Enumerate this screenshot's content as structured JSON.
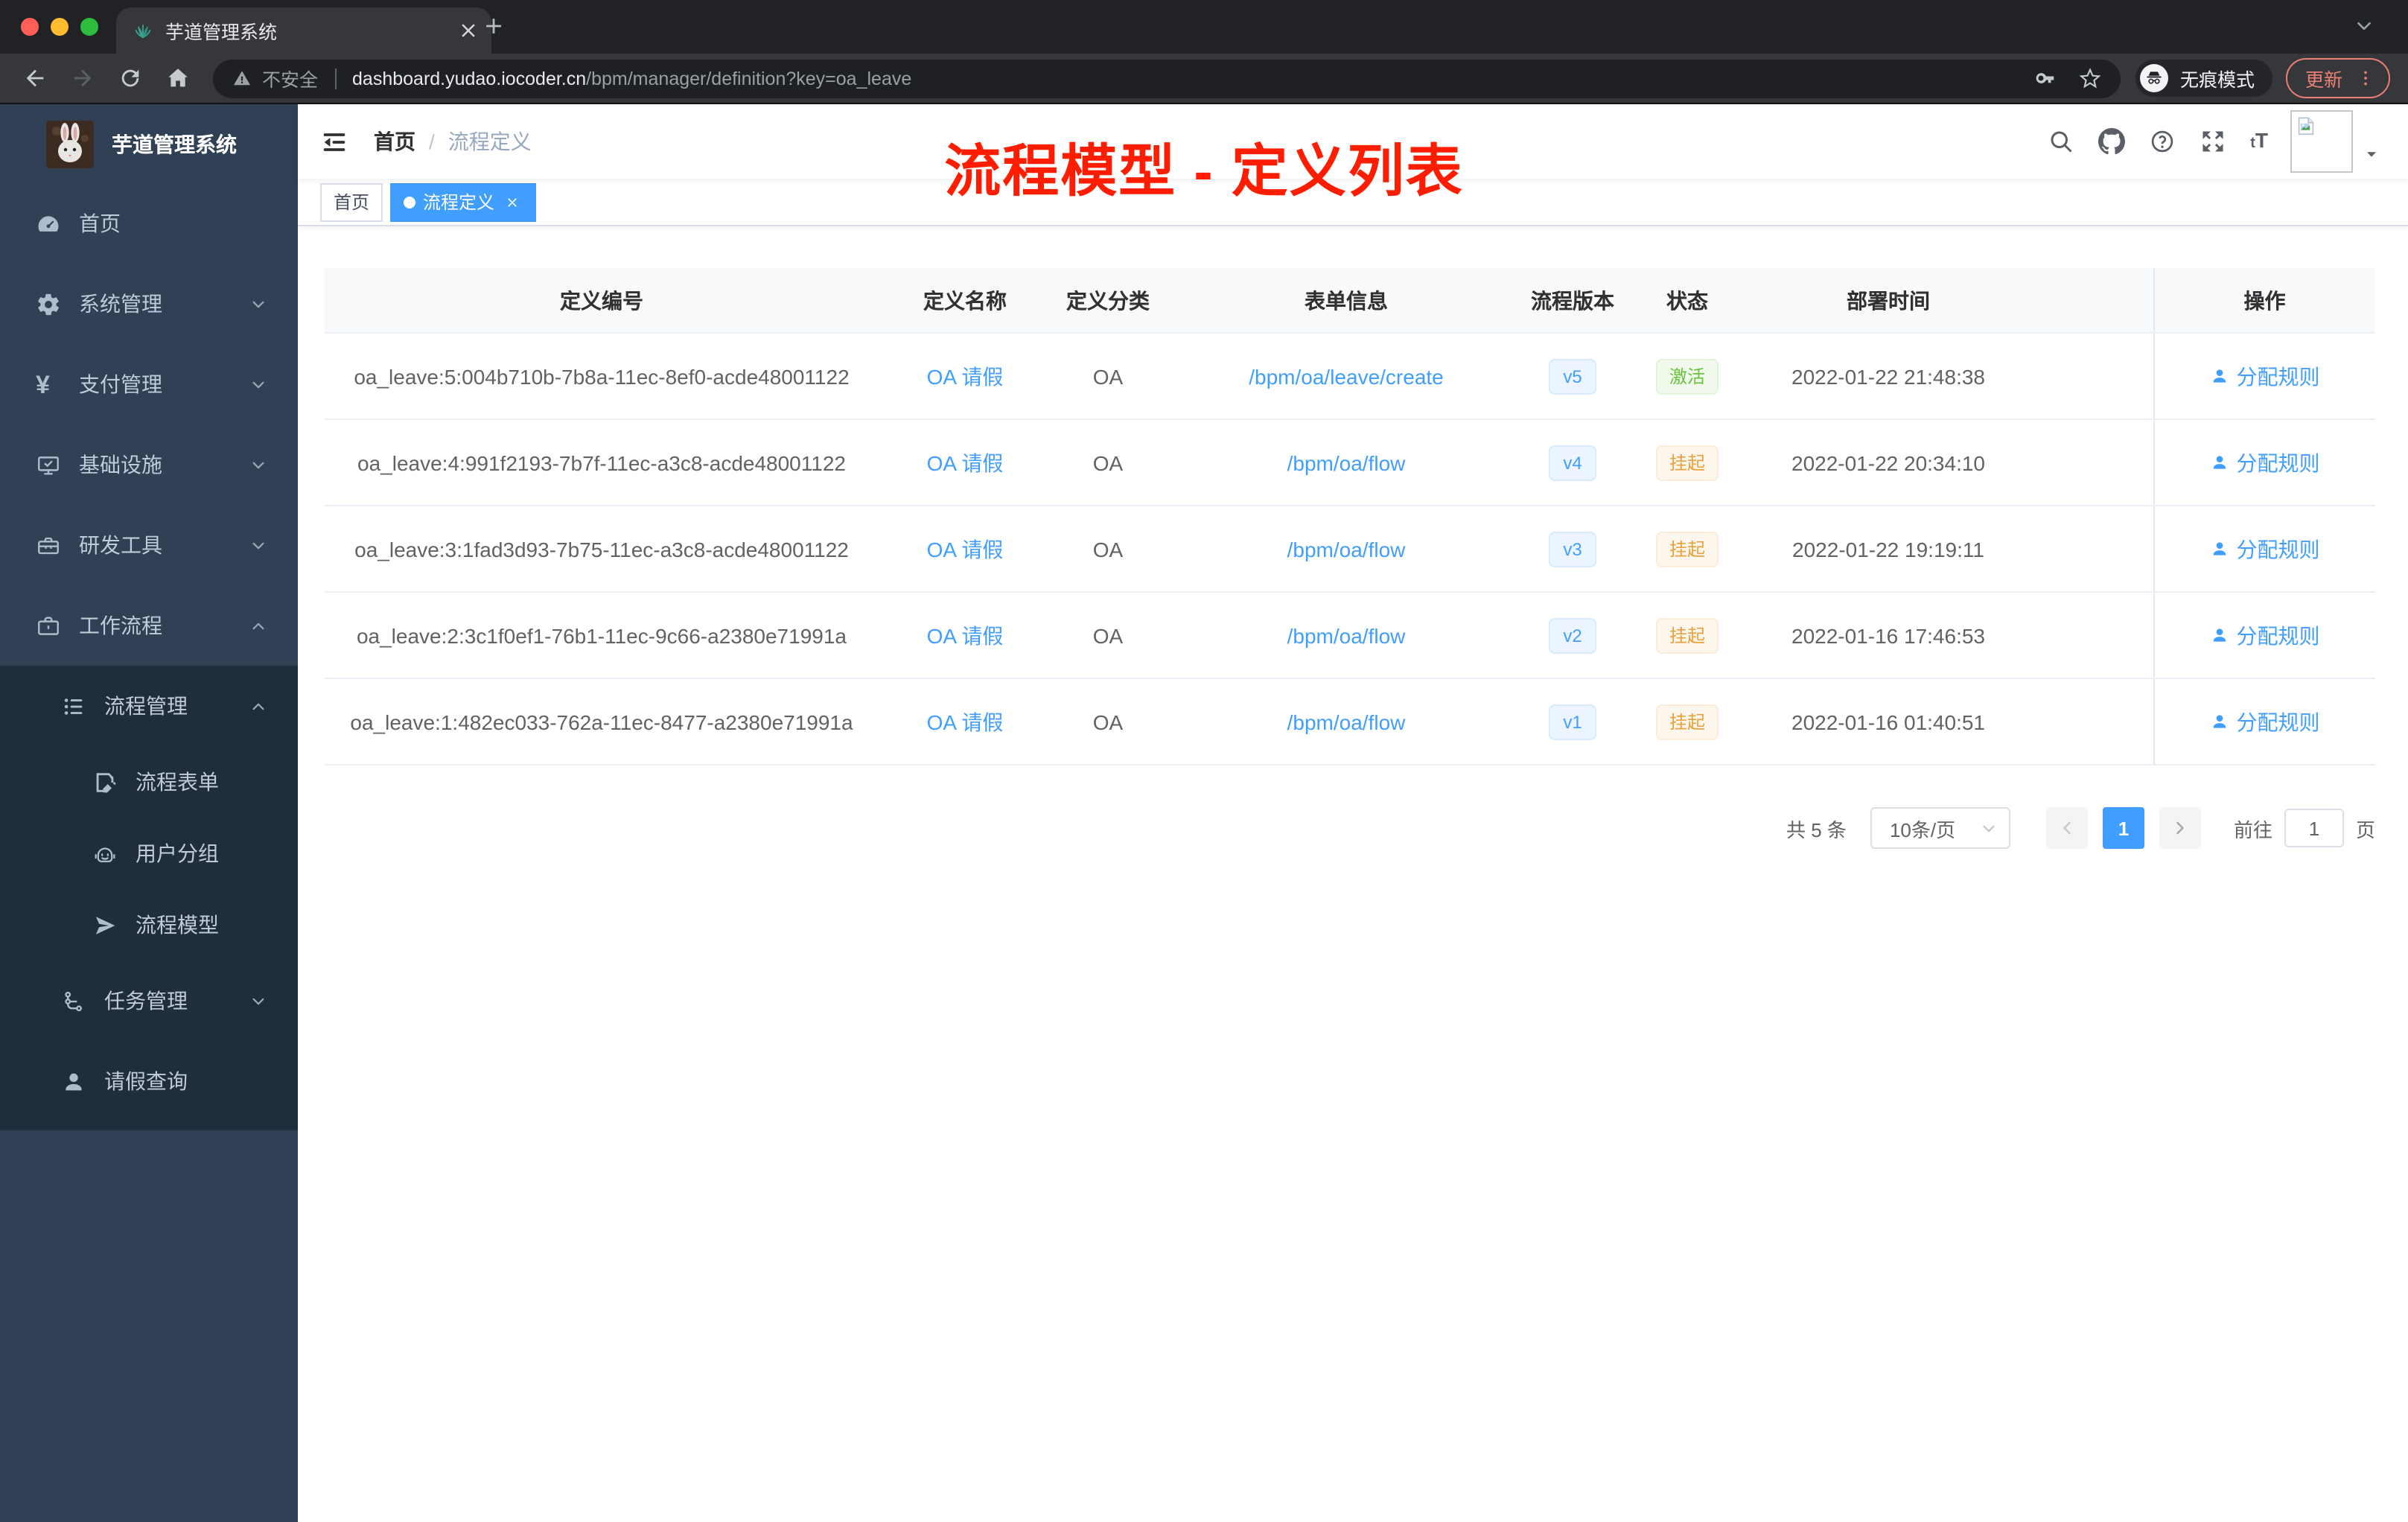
{
  "browser": {
    "tab_title": "芋道管理系统",
    "security_label": "不安全",
    "url_domain": "dashboard.yudao.iocoder.cn",
    "url_path": "/bpm/manager/definition?key=oa_leave",
    "incognito_label": "无痕模式",
    "update_label": "更新"
  },
  "sidebar": {
    "logo_title": "芋道管理系统",
    "menu": [
      {
        "key": "home",
        "label": "首页",
        "icon": "dashboard",
        "level": 1,
        "dark": false,
        "chevron": ""
      },
      {
        "key": "system",
        "label": "系统管理",
        "icon": "gear",
        "level": 1,
        "dark": false,
        "chevron": "down"
      },
      {
        "key": "payment",
        "label": "支付管理",
        "icon": "yen",
        "level": 1,
        "dark": false,
        "chevron": "down"
      },
      {
        "key": "infra",
        "label": "基础设施",
        "icon": "monitor",
        "level": 1,
        "dark": false,
        "chevron": "down"
      },
      {
        "key": "devtools",
        "label": "研发工具",
        "icon": "toolbox",
        "level": 1,
        "dark": false,
        "chevron": "down"
      },
      {
        "key": "workflow",
        "label": "工作流程",
        "icon": "briefcase",
        "level": 1,
        "dark": false,
        "chevron": "up"
      },
      {
        "key": "process-manage",
        "label": "流程管理",
        "icon": "listtree",
        "level": 2,
        "dark": true,
        "chevron": "up"
      },
      {
        "key": "process-form",
        "label": "流程表单",
        "icon": "formedit",
        "level": 3,
        "dark": true,
        "chevron": ""
      },
      {
        "key": "user-group",
        "label": "用户分组",
        "icon": "robot",
        "level": 3,
        "dark": true,
        "chevron": ""
      },
      {
        "key": "process-model",
        "label": "流程模型",
        "icon": "send",
        "level": 3,
        "dark": true,
        "chevron": ""
      },
      {
        "key": "task-manage",
        "label": "任务管理",
        "icon": "tree",
        "level": 2,
        "dark": true,
        "chevron": "down"
      },
      {
        "key": "leave-query",
        "label": "请假查询",
        "icon": "user",
        "level": 2,
        "dark": true,
        "chevron": ""
      }
    ]
  },
  "navbar": {
    "breadcrumb_home": "首页",
    "breadcrumb_sep": "/",
    "breadcrumb_current": "流程定义"
  },
  "tags": [
    {
      "label": "首页",
      "active": false,
      "closable": false
    },
    {
      "label": "流程定义",
      "active": true,
      "closable": true
    }
  ],
  "overlay_title": "流程模型 - 定义列表",
  "table": {
    "columns": [
      "定义编号",
      "定义名称",
      "定义分类",
      "表单信息",
      "流程版本",
      "状态",
      "部署时间",
      "操作"
    ],
    "rows": [
      {
        "id": "oa_leave:5:004b710b-7b8a-11ec-8ef0-acde48001122",
        "name": "OA 请假",
        "category": "OA",
        "form": "/bpm/oa/leave/create",
        "version": "v5",
        "status": "激活",
        "status_type": "success",
        "time": "2022-01-22 21:48:38",
        "action": "分配规则"
      },
      {
        "id": "oa_leave:4:991f2193-7b7f-11ec-a3c8-acde48001122",
        "name": "OA 请假",
        "category": "OA",
        "form": "/bpm/oa/flow",
        "version": "v4",
        "status": "挂起",
        "status_type": "warning",
        "time": "2022-01-22 20:34:10",
        "action": "分配规则"
      },
      {
        "id": "oa_leave:3:1fad3d93-7b75-11ec-a3c8-acde48001122",
        "name": "OA 请假",
        "category": "OA",
        "form": "/bpm/oa/flow",
        "version": "v3",
        "status": "挂起",
        "status_type": "warning",
        "time": "2022-01-22 19:19:11",
        "action": "分配规则"
      },
      {
        "id": "oa_leave:2:3c1f0ef1-76b1-11ec-9c66-a2380e71991a",
        "name": "OA 请假",
        "category": "OA",
        "form": "/bpm/oa/flow",
        "version": "v2",
        "status": "挂起",
        "status_type": "warning",
        "time": "2022-01-16 17:46:53",
        "action": "分配规则"
      },
      {
        "id": "oa_leave:1:482ec033-762a-11ec-8477-a2380e71991a",
        "name": "OA 请假",
        "category": "OA",
        "form": "/bpm/oa/flow",
        "version": "v1",
        "status": "挂起",
        "status_type": "warning",
        "time": "2022-01-16 01:40:51",
        "action": "分配规则"
      }
    ]
  },
  "pagination": {
    "total": "共 5 条",
    "page_size": "10条/页",
    "current_page": "1",
    "goto_label": "前往",
    "goto_value": "1",
    "page_unit": "页"
  },
  "colors": {
    "accent": "#409eff",
    "success": "#67c23a",
    "warning": "#e6a23c",
    "sidebar": "#304156",
    "sidebar_dark": "#1f2d3d",
    "annotation": "#fe1d00"
  }
}
